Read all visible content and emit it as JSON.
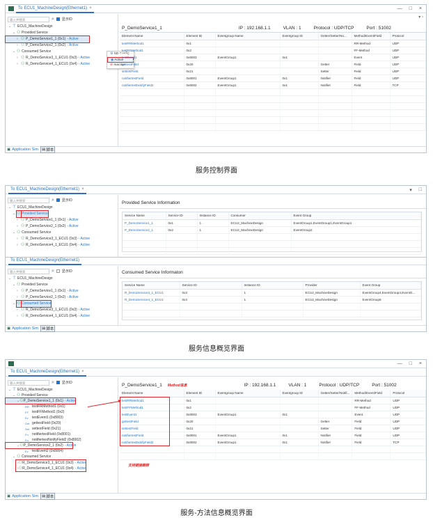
{
  "app": {
    "logo_text": "ECU",
    "tab_title": "ECU1_MachineDesign(Ethernet1)",
    "tab_prefix": "To",
    "close_glyph": "×",
    "minimize_glyph": "—",
    "maximize_glyph": "□",
    "restore_glyph": "▾",
    "pane_max_glyph": "□"
  },
  "tree": {
    "search_placeholder": "输入并搜索",
    "show_id_label": "显示ID",
    "root": "ECU1_MachineDesign",
    "provided_service": "Provided Service",
    "consumed_service": "Consumed Service",
    "ps1": "P_DemoService1_1 (0x1)",
    "ps2": "P_DemoService2_1 (0x2)",
    "cs1": "R_DemoService3_1_ECU1 (0x3)",
    "cs2": "R_DemoService4_1_ECU1 (0x4)",
    "active": "- Active",
    "methods": [
      {
        "label": "testRRMethod1 (0x1)",
        "icon": "RR"
      },
      {
        "label": "testFFMethod1 (0x2)",
        "icon": "FF"
      },
      {
        "label": "testEvent1 (0x8003)",
        "icon": "Ev"
      },
      {
        "label": "gettestField (0x20)",
        "icon": "Get"
      },
      {
        "label": "settestField (0x21)",
        "icon": "Set"
      },
      {
        "label": "notifiertestField (0x8001)",
        "icon": "Fn"
      },
      {
        "label": "notifiertestNotifyField2 (0x8002)",
        "icon": "Fn"
      }
    ],
    "ps2_child": "testEvent2 (0x8004)"
  },
  "bottom": {
    "app_sim": "Application Sim",
    "script": "脚本"
  },
  "service_header": {
    "name": "P_DemoService1_1",
    "ip": "IP : 192.168.1.1",
    "vlan": "VLAN : 1",
    "protocol": "Protocol : UDP/TCP",
    "port": "Port : 51002",
    "method_tag": "Method信息"
  },
  "method_table": {
    "columns": [
      "Element Name",
      "Element ID",
      "Eventgroup Name",
      "Eventgroup ID",
      "Getter/Setter/No...",
      "Method/Event/Field",
      "Protocol"
    ],
    "columns3": [
      "Element Name",
      "Element ID",
      "Eventgroup Name",
      "Eventgroup ID",
      "Getter/Setter/Notifi...",
      "Method/Event/Field",
      "Protocol"
    ],
    "rows": [
      [
        "testRRMethod1",
        "0x1",
        "",
        "",
        "",
        "RR-Method",
        "UDP"
      ],
      [
        "testFFMethod1",
        "0x2",
        "",
        "",
        "",
        "FF-Method",
        "UDP"
      ],
      [
        "testEvent1",
        "0x8003",
        "EventGroup1",
        "0x1",
        "",
        "Event",
        "UDP"
      ],
      [
        "gettestField",
        "0x20",
        "",
        "",
        "Getter",
        "Field",
        "UDP"
      ],
      [
        "settestField",
        "0x21",
        "",
        "",
        "Setter",
        "Field",
        "UDP"
      ],
      [
        "notifiertestField",
        "0x8001",
        "EventGroup1",
        "0x1",
        "Notifier",
        "Field",
        "UDP"
      ],
      [
        "notifiertestNotifyField2",
        "0x8002",
        "EventGroup1",
        "0x1",
        "Notifier",
        "Field",
        "TCP"
      ]
    ]
  },
  "popup": {
    "sd_config": "SD Config",
    "active": "Active",
    "inactive": "Inactive"
  },
  "provided_info": {
    "title": "Provided Service Information",
    "columns": [
      "Service Name",
      "Service ID",
      "Instance ID",
      "Consumer",
      "Event Group"
    ],
    "rows": [
      [
        "P_DemoService1_1",
        "0x1",
        "1",
        "ECU2_MachineDesign",
        "EventGroup1,EventGroup1,EventGroup1"
      ],
      [
        "P_DemoService2_1",
        "0x2",
        "1",
        "ECU2_MachineDesign",
        "EventGroup2"
      ]
    ]
  },
  "consumed_info": {
    "title": "Consumed Service Informaton",
    "columns": [
      "Service Name",
      "Service ID",
      "Instance ID",
      "Provider",
      "Event Group"
    ],
    "rows": [
      [
        "R_DemoService3_1_ECU1",
        "0x3",
        "1",
        "ECU2_MachineDesign",
        "EventGroup4,EventGroup4,EventG..."
      ],
      [
        "R_DemoService4_1_ECU1",
        "0x4",
        "1",
        "ECU2_MachineDesign",
        "EventGroup5"
      ]
    ]
  },
  "annotations": {
    "link_jump": "支持链接跳转"
  },
  "captions": {
    "c1": "服务控制界面",
    "c2": "服务信息概览界面",
    "c3": "服务-方法信息概览界面"
  }
}
